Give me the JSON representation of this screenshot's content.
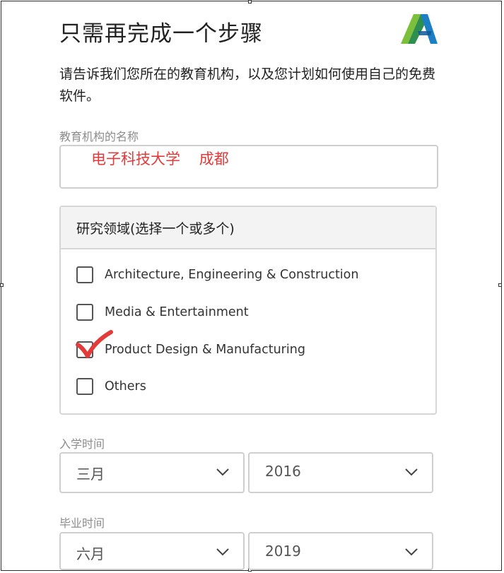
{
  "page": {
    "title": "只需再完成一个步骤",
    "subtitle": "请告诉我们您所在的教育机构，以及您计划如何使用自己的免费软件。"
  },
  "institution": {
    "label": "教育机构的名称",
    "value": "电子科技大学    成都"
  },
  "research": {
    "title": "研究领域(选择一个或多个)",
    "options": [
      {
        "label": "Architecture, Engineering & Construction",
        "checked": false
      },
      {
        "label": "Media & Entertainment",
        "checked": false
      },
      {
        "label": "Product Design & Manufacturing",
        "checked": false,
        "hand_drawn_check": true
      },
      {
        "label": "Others",
        "checked": false
      }
    ]
  },
  "enrollment": {
    "label": "入学时间",
    "month": "三月",
    "year": "2016"
  },
  "graduation": {
    "label": "毕业时间",
    "month": "六月",
    "year": "2019"
  },
  "colors": {
    "annotation_red": "#e33a3a",
    "border": "#cfcfcf",
    "panel_header_bg": "#f3f3f3"
  },
  "icons": [
    "autodesk-logo",
    "chevron-down-icon",
    "hand-drawn-checkmark"
  ]
}
